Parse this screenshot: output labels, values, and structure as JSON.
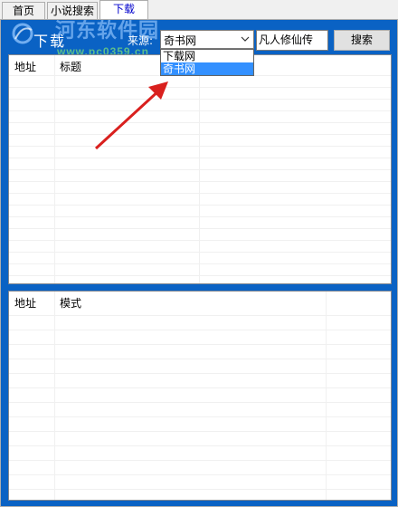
{
  "tabs": [
    {
      "label": "首页"
    },
    {
      "label": "小说搜索"
    },
    {
      "label": "下载"
    }
  ],
  "download_title": "下载",
  "watermark": {
    "text": "河东软件园",
    "url": "www.pc0359.cn"
  },
  "source": {
    "label": "来源:",
    "value": "奇书网",
    "options": [
      "下载网",
      "奇书网"
    ],
    "selected_index": 1
  },
  "keyword": {
    "value": "凡人修仙传"
  },
  "search_button": {
    "label": "搜索"
  },
  "top_grid": {
    "columns": [
      "地址",
      "标题"
    ]
  },
  "bottom_grid": {
    "columns": [
      "地址",
      "模式"
    ]
  },
  "colors": {
    "page_bg": "#0a62c4",
    "selection": "#3390ff",
    "arrow": "#d9201e",
    "active_tab_text": "#0000cc"
  }
}
